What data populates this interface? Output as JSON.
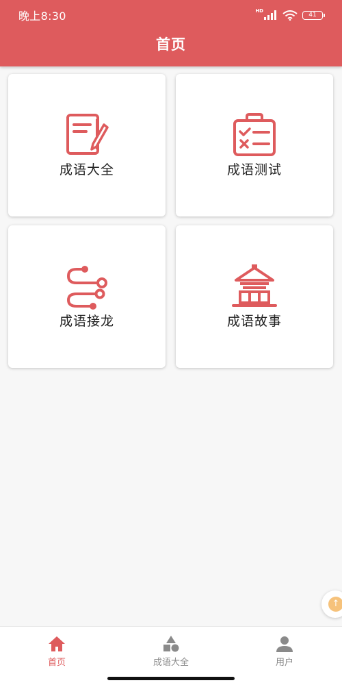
{
  "status_bar": {
    "time": "晚上8:30",
    "network_label": "HD",
    "battery": "41",
    "icons": [
      "signal-icon",
      "wifi-icon",
      "battery-icon"
    ]
  },
  "header": {
    "title": "首页",
    "color": "#de5b5d"
  },
  "accent_color": "#de5b5d",
  "cards": [
    {
      "label": "成语大全",
      "icon": "notebook-pen-icon"
    },
    {
      "label": "成语测试",
      "icon": "checklist-clipboard-icon"
    },
    {
      "label": "成语接龙",
      "icon": "chain-path-icon"
    },
    {
      "label": "成语故事",
      "icon": "pavilion-icon"
    }
  ],
  "bottom_nav": {
    "items": [
      {
        "label": "首页",
        "icon": "home-icon",
        "active": true
      },
      {
        "label": "成语大全",
        "icon": "shapes-icon",
        "active": false
      },
      {
        "label": "用户",
        "icon": "user-icon",
        "active": false
      }
    ],
    "active_color": "#de5b5d",
    "inactive_color": "#8a8a8a"
  }
}
